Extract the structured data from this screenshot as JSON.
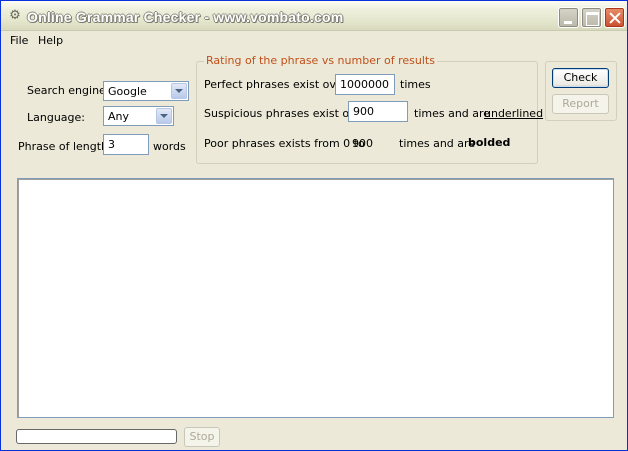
{
  "window": {
    "title": "Online Grammar Checker - www.vombato.com",
    "icon": "app-icon"
  },
  "menu": {
    "file": "File",
    "help": "Help"
  },
  "form": {
    "search_engine_label": "Search engine:",
    "search_engine_value": "Google",
    "language_label": "Language:",
    "language_value": "Any",
    "phrase_length_label": "Phrase of length",
    "phrase_length_value": "3",
    "words_label": "words"
  },
  "rating": {
    "legend": "Rating of the phrase vs number of results",
    "perfect_label": "Perfect phrases exist over",
    "perfect_value": "1000000",
    "perfect_suffix": "times",
    "suspicious_label": "Suspicious phrases exist over",
    "suspicious_value": "900",
    "suspicious_suffix": "times and are",
    "suspicious_style": "underlined",
    "poor_label": "Poor phrases exists from 0 to",
    "poor_value": "900",
    "poor_suffix": "times and are",
    "poor_style": "bolded"
  },
  "buttons": {
    "check": "Check",
    "report": "Report",
    "stop": "Stop"
  },
  "progress": {
    "fraction": 0
  },
  "colors": {
    "window_bg": "#ece9d8",
    "legend_text": "#c0501a",
    "input_border": "#7f9db9"
  }
}
